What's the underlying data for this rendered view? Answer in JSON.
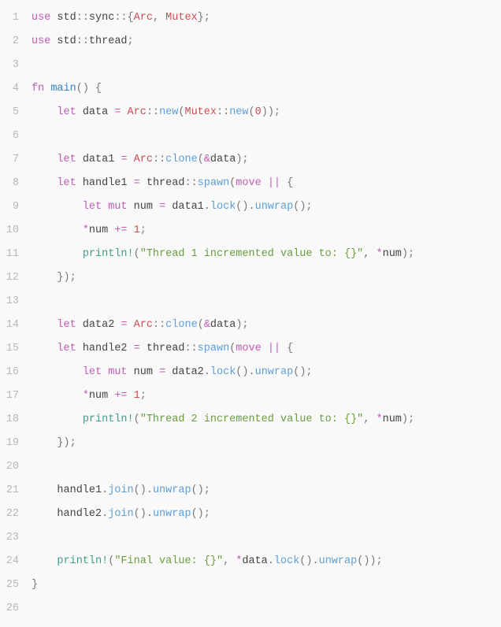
{
  "lines": [
    {
      "n": "1",
      "tokens": [
        {
          "c": "kw",
          "t": "use"
        },
        {
          "c": "id",
          "t": " std"
        },
        {
          "c": "pun",
          "t": "::"
        },
        {
          "c": "id",
          "t": "sync"
        },
        {
          "c": "pun",
          "t": "::{"
        },
        {
          "c": "ty",
          "t": "Arc"
        },
        {
          "c": "pun",
          "t": ", "
        },
        {
          "c": "ty",
          "t": "Mutex"
        },
        {
          "c": "pun",
          "t": "};"
        }
      ]
    },
    {
      "n": "2",
      "tokens": [
        {
          "c": "kw",
          "t": "use"
        },
        {
          "c": "id",
          "t": " std"
        },
        {
          "c": "pun",
          "t": "::"
        },
        {
          "c": "id",
          "t": "thread"
        },
        {
          "c": "pun",
          "t": ";"
        }
      ]
    },
    {
      "n": "3",
      "tokens": []
    },
    {
      "n": "4",
      "tokens": [
        {
          "c": "kw",
          "t": "fn"
        },
        {
          "c": "id",
          "t": " "
        },
        {
          "c": "fn2",
          "t": "main"
        },
        {
          "c": "pun",
          "t": "() {"
        }
      ]
    },
    {
      "n": "5",
      "tokens": [
        {
          "c": "id",
          "t": "    "
        },
        {
          "c": "kw",
          "t": "let"
        },
        {
          "c": "id",
          "t": " data "
        },
        {
          "c": "opc",
          "t": "="
        },
        {
          "c": "id",
          "t": " "
        },
        {
          "c": "ty",
          "t": "Arc"
        },
        {
          "c": "pun",
          "t": "::"
        },
        {
          "c": "fn",
          "t": "new"
        },
        {
          "c": "pun",
          "t": "("
        },
        {
          "c": "ty",
          "t": "Mutex"
        },
        {
          "c": "pun",
          "t": "::"
        },
        {
          "c": "fn",
          "t": "new"
        },
        {
          "c": "pun",
          "t": "("
        },
        {
          "c": "num",
          "t": "0"
        },
        {
          "c": "pun",
          "t": "));"
        }
      ]
    },
    {
      "n": "6",
      "tokens": []
    },
    {
      "n": "7",
      "tokens": [
        {
          "c": "id",
          "t": "    "
        },
        {
          "c": "kw",
          "t": "let"
        },
        {
          "c": "id",
          "t": " data1 "
        },
        {
          "c": "opc",
          "t": "="
        },
        {
          "c": "id",
          "t": " "
        },
        {
          "c": "ty",
          "t": "Arc"
        },
        {
          "c": "pun",
          "t": "::"
        },
        {
          "c": "fn",
          "t": "clone"
        },
        {
          "c": "pun",
          "t": "("
        },
        {
          "c": "opc",
          "t": "&"
        },
        {
          "c": "id",
          "t": "data"
        },
        {
          "c": "pun",
          "t": ");"
        }
      ]
    },
    {
      "n": "8",
      "tokens": [
        {
          "c": "id",
          "t": "    "
        },
        {
          "c": "kw",
          "t": "let"
        },
        {
          "c": "id",
          "t": " handle1 "
        },
        {
          "c": "opc",
          "t": "="
        },
        {
          "c": "id",
          "t": " thread"
        },
        {
          "c": "pun",
          "t": "::"
        },
        {
          "c": "fn",
          "t": "spawn"
        },
        {
          "c": "pun",
          "t": "("
        },
        {
          "c": "kw",
          "t": "move"
        },
        {
          "c": "id",
          "t": " "
        },
        {
          "c": "opc",
          "t": "||"
        },
        {
          "c": "pun",
          "t": " {"
        }
      ]
    },
    {
      "n": "9",
      "tokens": [
        {
          "c": "id",
          "t": "        "
        },
        {
          "c": "kw",
          "t": "let"
        },
        {
          "c": "id",
          "t": " "
        },
        {
          "c": "kw",
          "t": "mut"
        },
        {
          "c": "id",
          "t": " num "
        },
        {
          "c": "opc",
          "t": "="
        },
        {
          "c": "id",
          "t": " data1"
        },
        {
          "c": "pun",
          "t": "."
        },
        {
          "c": "fn",
          "t": "lock"
        },
        {
          "c": "pun",
          "t": "()."
        },
        {
          "c": "fn",
          "t": "unwrap"
        },
        {
          "c": "pun",
          "t": "();"
        }
      ]
    },
    {
      "n": "10",
      "tokens": [
        {
          "c": "id",
          "t": "        "
        },
        {
          "c": "opc",
          "t": "*"
        },
        {
          "c": "id",
          "t": "num "
        },
        {
          "c": "opc",
          "t": "+="
        },
        {
          "c": "id",
          "t": " "
        },
        {
          "c": "num",
          "t": "1"
        },
        {
          "c": "pun",
          "t": ";"
        }
      ]
    },
    {
      "n": "11",
      "tokens": [
        {
          "c": "id",
          "t": "        "
        },
        {
          "c": "mcr",
          "t": "println!"
        },
        {
          "c": "pun",
          "t": "("
        },
        {
          "c": "str",
          "t": "\"Thread 1 incremented value to: {}\""
        },
        {
          "c": "pun",
          "t": ", "
        },
        {
          "c": "opc",
          "t": "*"
        },
        {
          "c": "id",
          "t": "num"
        },
        {
          "c": "pun",
          "t": ");"
        }
      ]
    },
    {
      "n": "12",
      "tokens": [
        {
          "c": "id",
          "t": "    "
        },
        {
          "c": "pun",
          "t": "});"
        }
      ]
    },
    {
      "n": "13",
      "tokens": []
    },
    {
      "n": "14",
      "tokens": [
        {
          "c": "id",
          "t": "    "
        },
        {
          "c": "kw",
          "t": "let"
        },
        {
          "c": "id",
          "t": " data2 "
        },
        {
          "c": "opc",
          "t": "="
        },
        {
          "c": "id",
          "t": " "
        },
        {
          "c": "ty",
          "t": "Arc"
        },
        {
          "c": "pun",
          "t": "::"
        },
        {
          "c": "fn",
          "t": "clone"
        },
        {
          "c": "pun",
          "t": "("
        },
        {
          "c": "opc",
          "t": "&"
        },
        {
          "c": "id",
          "t": "data"
        },
        {
          "c": "pun",
          "t": ");"
        }
      ]
    },
    {
      "n": "15",
      "tokens": [
        {
          "c": "id",
          "t": "    "
        },
        {
          "c": "kw",
          "t": "let"
        },
        {
          "c": "id",
          "t": " handle2 "
        },
        {
          "c": "opc",
          "t": "="
        },
        {
          "c": "id",
          "t": " thread"
        },
        {
          "c": "pun",
          "t": "::"
        },
        {
          "c": "fn",
          "t": "spawn"
        },
        {
          "c": "pun",
          "t": "("
        },
        {
          "c": "kw",
          "t": "move"
        },
        {
          "c": "id",
          "t": " "
        },
        {
          "c": "opc",
          "t": "||"
        },
        {
          "c": "pun",
          "t": " {"
        }
      ]
    },
    {
      "n": "16",
      "tokens": [
        {
          "c": "id",
          "t": "        "
        },
        {
          "c": "kw",
          "t": "let"
        },
        {
          "c": "id",
          "t": " "
        },
        {
          "c": "kw",
          "t": "mut"
        },
        {
          "c": "id",
          "t": " num "
        },
        {
          "c": "opc",
          "t": "="
        },
        {
          "c": "id",
          "t": " data2"
        },
        {
          "c": "pun",
          "t": "."
        },
        {
          "c": "fn",
          "t": "lock"
        },
        {
          "c": "pun",
          "t": "()."
        },
        {
          "c": "fn",
          "t": "unwrap"
        },
        {
          "c": "pun",
          "t": "();"
        }
      ]
    },
    {
      "n": "17",
      "tokens": [
        {
          "c": "id",
          "t": "        "
        },
        {
          "c": "opc",
          "t": "*"
        },
        {
          "c": "id",
          "t": "num "
        },
        {
          "c": "opc",
          "t": "+="
        },
        {
          "c": "id",
          "t": " "
        },
        {
          "c": "num",
          "t": "1"
        },
        {
          "c": "pun",
          "t": ";"
        }
      ]
    },
    {
      "n": "18",
      "tokens": [
        {
          "c": "id",
          "t": "        "
        },
        {
          "c": "mcr",
          "t": "println!"
        },
        {
          "c": "pun",
          "t": "("
        },
        {
          "c": "str",
          "t": "\"Thread 2 incremented value to: {}\""
        },
        {
          "c": "pun",
          "t": ", "
        },
        {
          "c": "opc",
          "t": "*"
        },
        {
          "c": "id",
          "t": "num"
        },
        {
          "c": "pun",
          "t": ");"
        }
      ]
    },
    {
      "n": "19",
      "tokens": [
        {
          "c": "id",
          "t": "    "
        },
        {
          "c": "pun",
          "t": "});"
        }
      ]
    },
    {
      "n": "20",
      "tokens": []
    },
    {
      "n": "21",
      "tokens": [
        {
          "c": "id",
          "t": "    handle1"
        },
        {
          "c": "pun",
          "t": "."
        },
        {
          "c": "fn",
          "t": "join"
        },
        {
          "c": "pun",
          "t": "()."
        },
        {
          "c": "fn",
          "t": "unwrap"
        },
        {
          "c": "pun",
          "t": "();"
        }
      ]
    },
    {
      "n": "22",
      "tokens": [
        {
          "c": "id",
          "t": "    handle2"
        },
        {
          "c": "pun",
          "t": "."
        },
        {
          "c": "fn",
          "t": "join"
        },
        {
          "c": "pun",
          "t": "()."
        },
        {
          "c": "fn",
          "t": "unwrap"
        },
        {
          "c": "pun",
          "t": "();"
        }
      ]
    },
    {
      "n": "23",
      "tokens": []
    },
    {
      "n": "24",
      "tokens": [
        {
          "c": "id",
          "t": "    "
        },
        {
          "c": "mcr",
          "t": "println!"
        },
        {
          "c": "pun",
          "t": "("
        },
        {
          "c": "str",
          "t": "\"Final value: {}\""
        },
        {
          "c": "pun",
          "t": ", "
        },
        {
          "c": "opc",
          "t": "*"
        },
        {
          "c": "id",
          "t": "data"
        },
        {
          "c": "pun",
          "t": "."
        },
        {
          "c": "fn",
          "t": "lock"
        },
        {
          "c": "pun",
          "t": "()."
        },
        {
          "c": "fn",
          "t": "unwrap"
        },
        {
          "c": "pun",
          "t": "());"
        }
      ]
    },
    {
      "n": "25",
      "tokens": [
        {
          "c": "pun",
          "t": "}"
        }
      ]
    },
    {
      "n": "26",
      "tokens": []
    }
  ]
}
